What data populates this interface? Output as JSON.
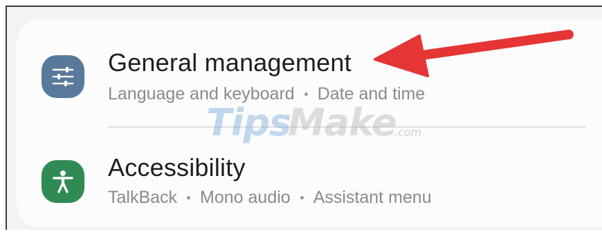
{
  "settings": {
    "general": {
      "title": "General management",
      "sub1": "Language and keyboard",
      "sub2": "Date and time",
      "icon": "sliders-icon",
      "color": "#58799b"
    },
    "accessibility": {
      "title": "Accessibility",
      "sub1": "TalkBack",
      "sub2": "Mono audio",
      "sub3": "Assistant menu",
      "icon": "accessibility-person-icon",
      "color": "#2f8a53"
    }
  },
  "annotation": {
    "arrow_color": "#e53535"
  },
  "watermark": {
    "part1": "Tips",
    "part2": "Make",
    "part3": ".com"
  }
}
